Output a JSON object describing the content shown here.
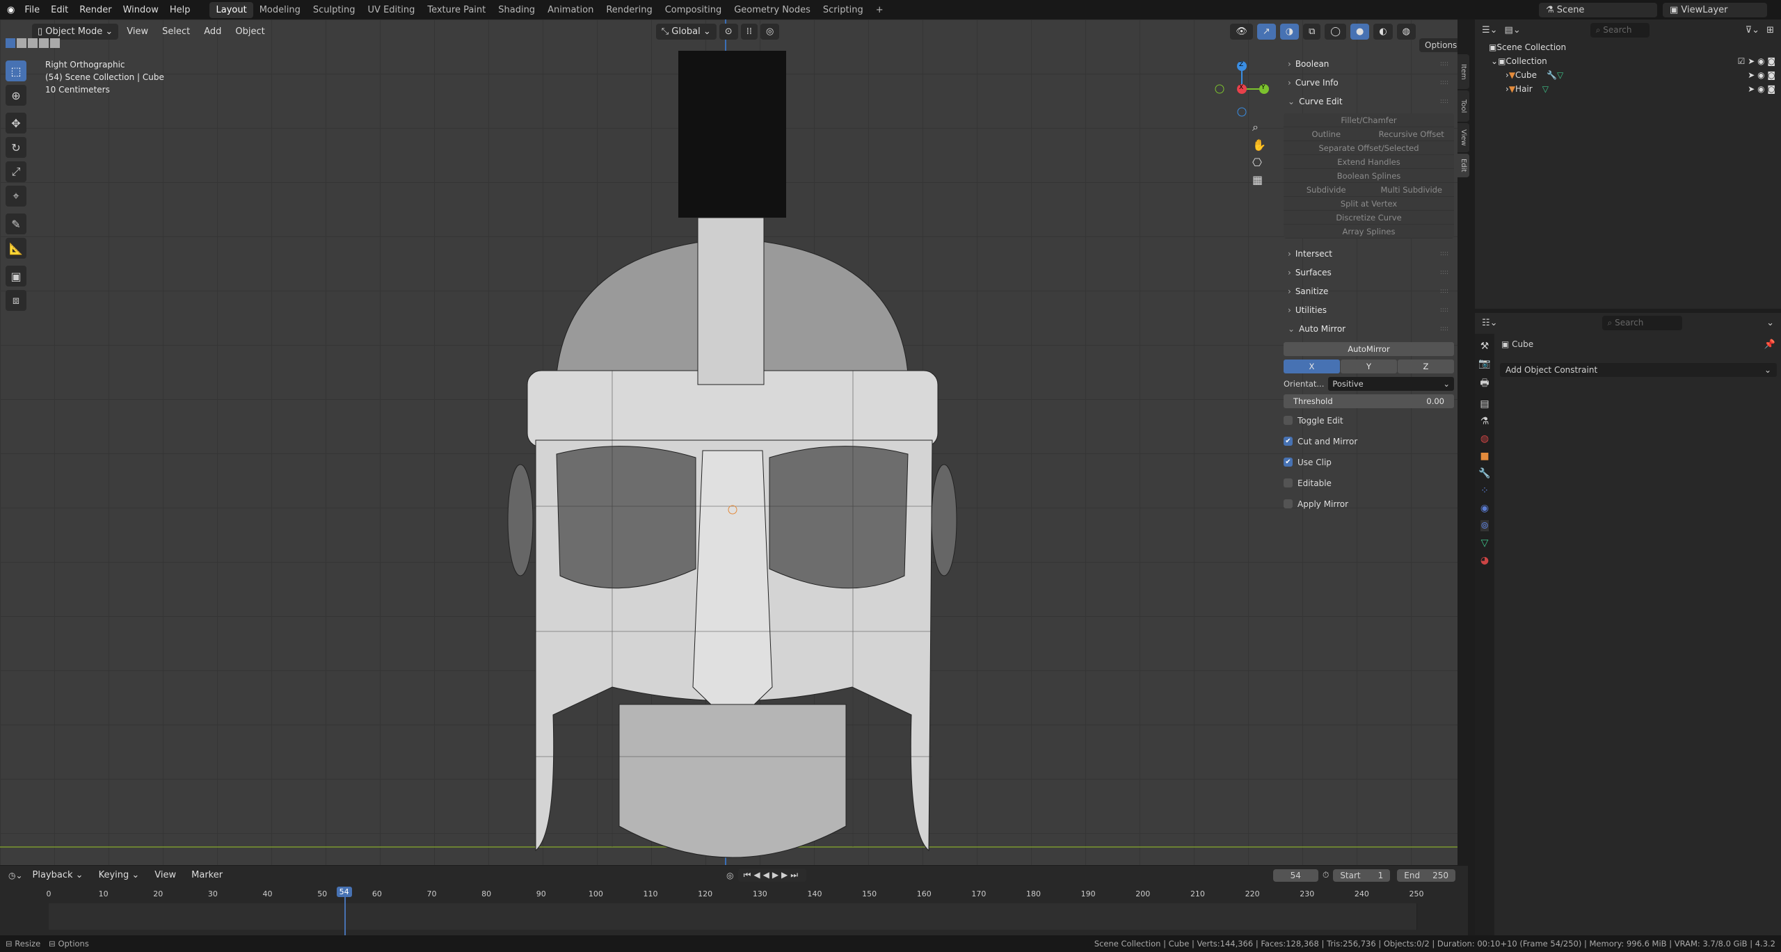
{
  "topbar": {
    "menus": [
      "File",
      "Edit",
      "Render",
      "Window",
      "Help"
    ],
    "workspaces": [
      "Layout",
      "Modeling",
      "Sculpting",
      "UV Editing",
      "Texture Paint",
      "Shading",
      "Animation",
      "Rendering",
      "Compositing",
      "Geometry Nodes",
      "Scripting"
    ],
    "active_workspace": "Layout",
    "add": "+",
    "scene": "Scene",
    "view_layer": "ViewLayer"
  },
  "viewport": {
    "mode": "Object Mode",
    "menus": [
      "View",
      "Select",
      "Add",
      "Object"
    ],
    "orientation": "Global",
    "options": "Options",
    "view_name": "Right Orthographic",
    "collection_info": "(54) Scene Collection | Cube",
    "scale": "10 Centimeters",
    "gizmo": {
      "x": "X",
      "y": "Y",
      "z": "Z"
    }
  },
  "npanel": {
    "tabs": [
      "Item",
      "Tool",
      "View",
      "Edit"
    ],
    "collapsed_top": [
      "Boolean",
      "Curve Info"
    ],
    "curve_edit": {
      "title": "Curve Edit",
      "rows": [
        [
          "Fillet/Chamfer"
        ],
        [
          "Outline",
          "Recursive Offset"
        ],
        [
          "Separate Offset/Selected"
        ],
        [
          "Extend Handles"
        ],
        [
          "Boolean Splines"
        ],
        [
          "Subdivide",
          "Multi Subdivide"
        ],
        [
          "Split at Vertex"
        ],
        [
          "Discretize Curve"
        ],
        [
          "Array Splines"
        ]
      ]
    },
    "collapsed_mid": [
      "Intersect",
      "Surfaces",
      "Sanitize",
      "Utilities"
    ],
    "auto_mirror": {
      "title": "Auto Mirror",
      "button": "AutoMirror",
      "axes": [
        "X",
        "Y",
        "Z"
      ],
      "active_axis": "X",
      "orientation_label": "Orientat...",
      "orientation_value": "Positive",
      "threshold_label": "Threshold",
      "threshold_value": "0.00",
      "checks": [
        {
          "label": "Toggle Edit",
          "checked": false
        },
        {
          "label": "Cut and Mirror",
          "checked": true
        },
        {
          "label": "Use Clip",
          "checked": true
        },
        {
          "label": "Editable",
          "checked": false
        },
        {
          "label": "Apply Mirror",
          "checked": false
        }
      ]
    }
  },
  "outliner": {
    "search_placeholder": "Search",
    "scene_collection": "Scene Collection",
    "collection": "Collection",
    "items": [
      "Cube",
      "Hair"
    ]
  },
  "properties": {
    "search_placeholder": "Search",
    "object": "Cube",
    "add_constraint": "Add Object Constraint"
  },
  "timeline": {
    "menus": [
      "Playback",
      "Keying",
      "View",
      "Marker"
    ],
    "current_frame": "54",
    "start_label": "Start",
    "start": "1",
    "end_label": "End",
    "end": "250",
    "ticks": [
      "0",
      "10",
      "20",
      "30",
      "40",
      "50",
      "60",
      "70",
      "80",
      "90",
      "100",
      "110",
      "120",
      "130",
      "140",
      "150",
      "160",
      "170",
      "180",
      "190",
      "200",
      "210",
      "220",
      "230",
      "240",
      "250"
    ],
    "playhead": 54
  },
  "status": {
    "left": [
      "Resize",
      "Options"
    ],
    "stats": "Scene Collection | Cube | Verts:144,366 | Faces:128,368 | Tris:256,736 | Objects:0/2 | Duration: 00:10+10 (Frame 54/250) | Memory: 996.6 MiB | VRAM: 3.7/8.0 GiB | 4.3.2"
  },
  "colors": {
    "accent": "#4772b3",
    "x_axis": "#e8414b",
    "y_axis": "#7cc22e",
    "z_axis": "#3a8de2",
    "object_orange": "#e38b3c",
    "mesh_green": "#3ec48a"
  }
}
